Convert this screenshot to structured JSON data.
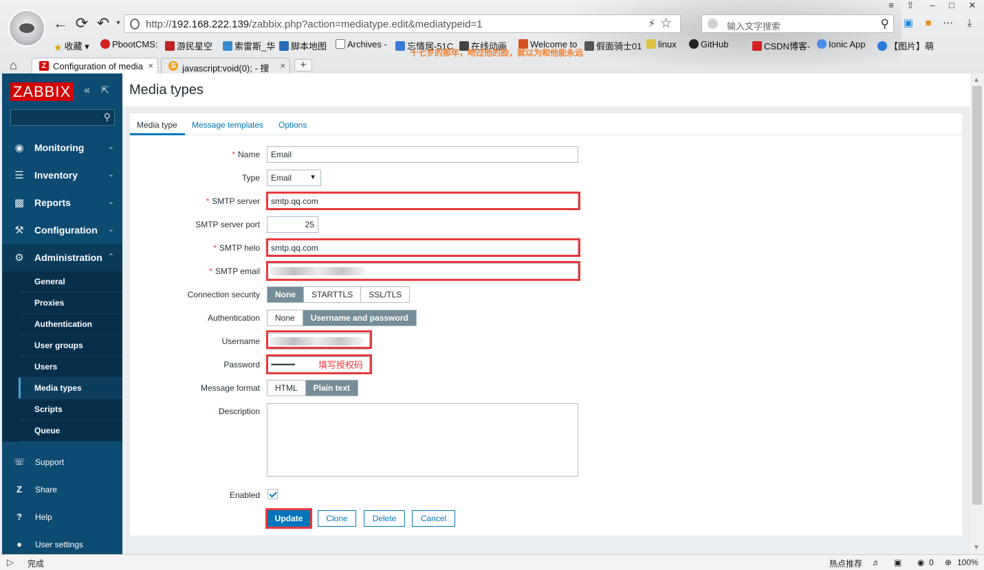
{
  "browser": {
    "url_prefix": "http://",
    "url_host": "192.168.222.139",
    "url_path": "/zabbix.php?action=mediatype.edit&mediatypeid=1",
    "search_placeholder": "输入文字搜索",
    "bookmarks": [
      "收藏",
      "PbootCMS:",
      "游民星空",
      "索雷斯_华",
      "脚本地图",
      "Archives -",
      "忘情居-51C",
      "在线动画",
      "Welcome to",
      "假面骑士01",
      "linux",
      "GitHub",
      "CSDN博客-",
      "Ionic App",
      "【图片】萌"
    ],
    "tagline": "十七岁的那年，吻过他的脸，就以为和他能永远",
    "tabs": [
      {
        "label": "Configuration of media",
        "favicon": "Z"
      },
      {
        "label": "javascript:void(0); - 搜",
        "favicon": "S"
      }
    ],
    "tab_close": "×",
    "new_tab": "+",
    "status_text": "完成",
    "status_hot": "热点推荐",
    "status_count": "0",
    "zoom": "100%"
  },
  "sidebar": {
    "logo": "ZABBIX",
    "menu": [
      {
        "label": "Monitoring",
        "icon": "eye-icon"
      },
      {
        "label": "Inventory",
        "icon": "list-icon"
      },
      {
        "label": "Reports",
        "icon": "bar-chart-icon"
      },
      {
        "label": "Configuration",
        "icon": "wrench-icon"
      },
      {
        "label": "Administration",
        "icon": "gear-icon"
      }
    ],
    "submenu": [
      "General",
      "Proxies",
      "Authentication",
      "User groups",
      "Users",
      "Media types",
      "Scripts",
      "Queue"
    ],
    "selected_submenu": "Media types",
    "footer": [
      {
        "label": "Support",
        "icon": "headset-icon"
      },
      {
        "label": "Share",
        "icon": "share-icon"
      },
      {
        "label": "Help",
        "icon": "help-icon"
      },
      {
        "label": "User settings",
        "icon": "user-icon"
      }
    ]
  },
  "page": {
    "title": "Media types",
    "tabs": [
      "Media type",
      "Message templates",
      "Options"
    ]
  },
  "form": {
    "name_label": "Name",
    "name_value": "Email",
    "type_label": "Type",
    "type_value": "Email",
    "smtp_server_label": "SMTP server",
    "smtp_server_value": "smtp.qq.com",
    "smtp_port_label": "SMTP server port",
    "smtp_port_value": "25",
    "smtp_helo_label": "SMTP helo",
    "smtp_helo_value": "smtp.qq.com",
    "smtp_email_label": "SMTP email",
    "connection_security_label": "Connection security",
    "connection_security_options": [
      "None",
      "STARTTLS",
      "SSL/TLS"
    ],
    "connection_security_selected": "None",
    "authentication_label": "Authentication",
    "authentication_options": [
      "None",
      "Username and password"
    ],
    "authentication_selected": "Username and password",
    "username_label": "Username",
    "password_label": "Password",
    "password_value": "••••••••••••••••",
    "password_note": "填写授权码",
    "message_format_label": "Message format",
    "message_format_options": [
      "HTML",
      "Plain text"
    ],
    "message_format_selected": "Plain text",
    "description_label": "Description",
    "description_value": "",
    "enabled_label": "Enabled",
    "enabled_checked": true,
    "buttons": {
      "update": "Update",
      "clone": "Clone",
      "delete": "Delete",
      "cancel": "Cancel"
    }
  },
  "colors": {
    "accent": "#0275b8",
    "sidebar_bg": "#0e4b73",
    "logo_red": "#d40000",
    "annotation_red": "#e8393a"
  }
}
